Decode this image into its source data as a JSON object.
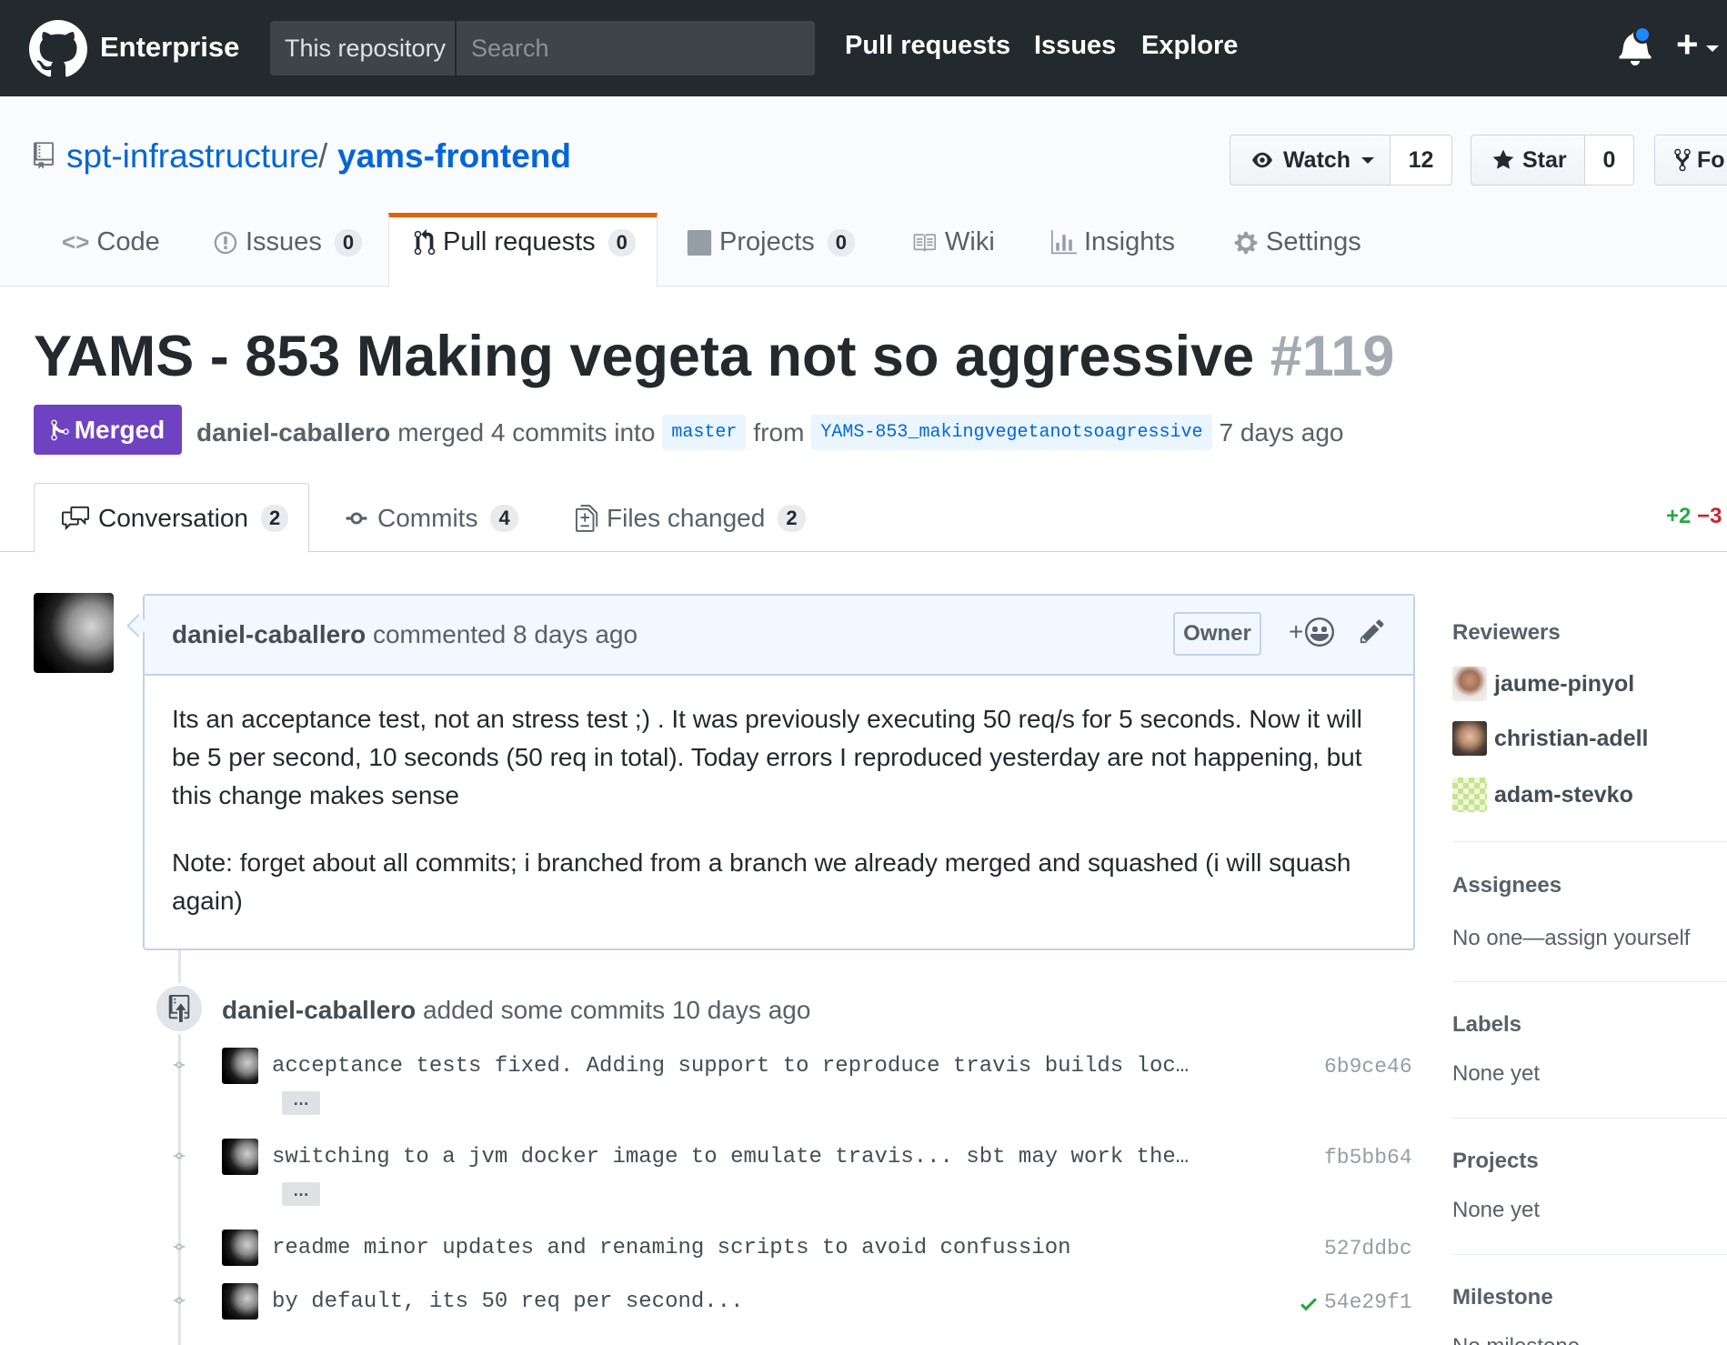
{
  "header": {
    "brand": "Enterprise",
    "scope": "This repository",
    "search_placeholder": "Search",
    "nav": [
      "Pull requests",
      "Issues",
      "Explore"
    ]
  },
  "repo": {
    "owner": "spt-infrastructure",
    "separator": "/",
    "name": "yams-frontend",
    "watch_label": "Watch",
    "watch_count": "12",
    "star_label": "Star",
    "star_count": "0",
    "fork_label": "Fo"
  },
  "repo_nav": [
    {
      "label": "Code"
    },
    {
      "label": "Issues",
      "count": "0"
    },
    {
      "label": "Pull requests",
      "count": "0"
    },
    {
      "label": "Projects",
      "count": "0"
    },
    {
      "label": "Wiki"
    },
    {
      "label": "Insights"
    },
    {
      "label": "Settings"
    }
  ],
  "pr": {
    "title": "YAMS - 853 Making vegeta not so aggressive",
    "number": "#119",
    "state": "Merged",
    "author": "daniel-caballero",
    "merged_text": "merged 4 commits into",
    "base": "master",
    "from_text": "from",
    "head": "YAMS-853_makingvegetanotsoagressive",
    "time": "7 days ago"
  },
  "pr_tabs": [
    {
      "label": "Conversation",
      "count": "2"
    },
    {
      "label": "Commits",
      "count": "4"
    },
    {
      "label": "Files changed",
      "count": "2"
    }
  ],
  "diffstat": {
    "additions": "+2",
    "deletions": "−3"
  },
  "comment": {
    "author": "daniel-caballero",
    "action": "commented 8 days ago",
    "badge": "Owner",
    "reaction": "+",
    "paragraphs": [
      "Its an acceptance test, not an stress test ;) . It was previously executing 50 req/s for 5 seconds. Now it will be 5 per second, 10 seconds (50 req in total). Today errors I reproduced yesterday are not happening, but this change makes sense",
      "Note: forget about all commits; i branched from a branch we already merged and squashed (i will squash again)"
    ]
  },
  "timeline": {
    "author": "daniel-caballero",
    "action": "added some commits 10 days ago",
    "commits": [
      {
        "message": "acceptance tests fixed. Adding support to reproduce travis builds loc…",
        "sha": "6b9ce46",
        "expand": "…"
      },
      {
        "message": "switching to a jvm docker image to emulate travis... sbt may work the…",
        "sha": "fb5bb64",
        "expand": "…"
      },
      {
        "message": "readme minor updates and renaming scripts to avoid confussion",
        "sha": "527ddbc"
      },
      {
        "message": "by default, its 50 req per second...",
        "sha": "54e29f1",
        "status": "success"
      }
    ]
  },
  "sidebar": {
    "reviewers_title": "Reviewers",
    "reviewers": [
      "jaume-pinyol",
      "christian-adell",
      "adam-stevko"
    ],
    "assignees_title": "Assignees",
    "assignees_value": "No one—assign yourself",
    "labels_title": "Labels",
    "labels_value": "None yet",
    "projects_title": "Projects",
    "projects_value": "None yet",
    "milestone_title": "Milestone",
    "milestone_value": "No milestone"
  },
  "colors": {
    "header_bg": "#24292e",
    "link": "#0366d6",
    "merged": "#6f42c1",
    "tab_accent": "#e36209",
    "addition": "#28a745",
    "deletion": "#cb2431"
  }
}
